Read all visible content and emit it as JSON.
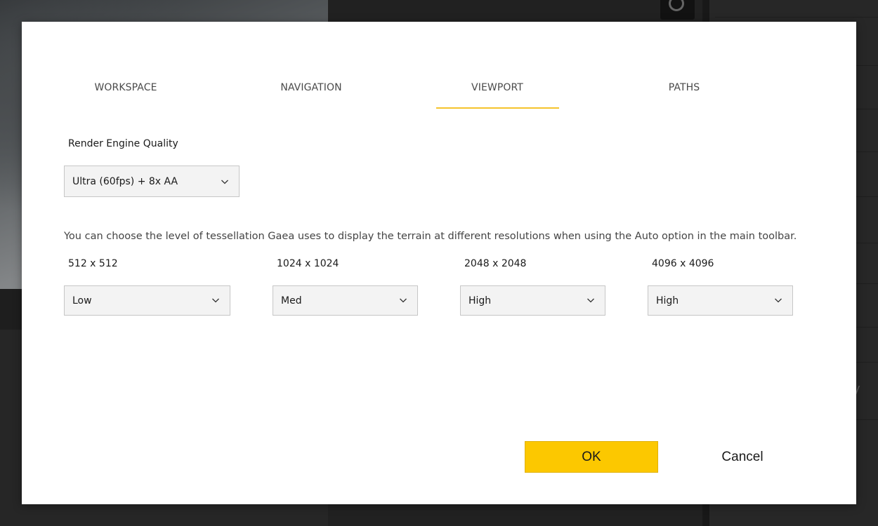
{
  "dialog": {
    "tabs": [
      {
        "label": "WORKSPACE",
        "active": false
      },
      {
        "label": "NAVIGATION",
        "active": false
      },
      {
        "label": "VIEWPORT",
        "active": true
      },
      {
        "label": "PATHS",
        "active": false
      }
    ],
    "render_quality": {
      "label": "Render Engine Quality",
      "value": "Ultra (60fps) + 8x AA"
    },
    "description": "You can choose the level of tessellation Gaea uses to display the terrain at different resolutions when using the Auto option in the main toolbar.",
    "tessellation": [
      {
        "label": "512 x 512",
        "value": "Low"
      },
      {
        "label": "1024 x 1024",
        "value": "Med"
      },
      {
        "label": "2048 x 2048",
        "value": "High"
      },
      {
        "label": "4096 x 4096",
        "value": "High"
      }
    ],
    "buttons": {
      "ok": "OK",
      "cancel": "Cancel"
    }
  },
  "background": {
    "right_panel_text": "y"
  },
  "colors": {
    "accent": "#fcc800",
    "tab_underline": "#f5c32c",
    "select_bg": "#f3f3f3",
    "select_border": "#c6c6c6"
  },
  "icons": {
    "dropdown": "chevron-down-icon",
    "toolbar": "refresh-icon"
  }
}
